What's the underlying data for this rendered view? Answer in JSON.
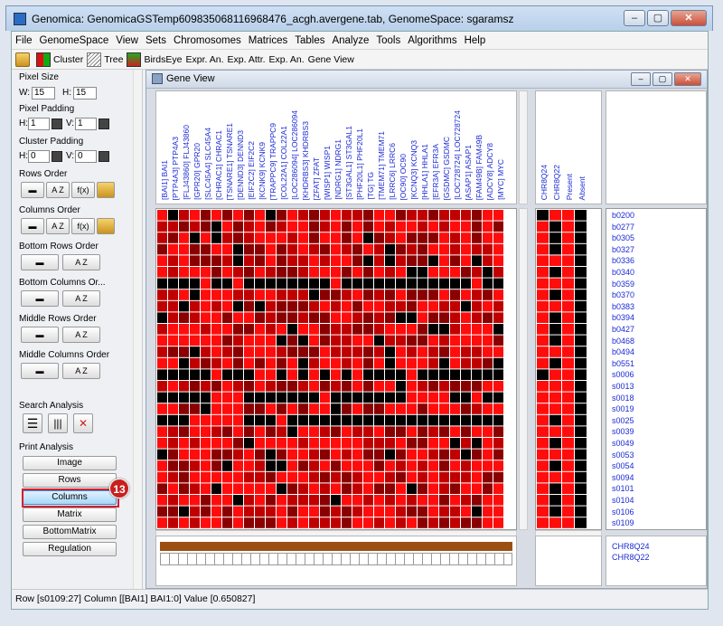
{
  "window": {
    "title": "Genomica: GenomicaGSTemp609835068116968476_acgh.avergene.tab, GenomeSpace: sgaramsz",
    "controls": [
      "–",
      "▢",
      "✕"
    ]
  },
  "menu": [
    "File",
    "GenomeSpace",
    "View",
    "Sets",
    "Chromosomes",
    "Matrices",
    "Tables",
    "Analyze",
    "Tools",
    "Algorithms",
    "Help"
  ],
  "toolbar": [
    "Cluster",
    "Tree",
    "BirdsEye",
    "Expr. An.",
    "Exp. Attr.",
    "Exp. An.",
    "Gene View"
  ],
  "left": {
    "pixel_size": "Pixel Size",
    "w_label": "W:",
    "w_value": "15",
    "h_label": "H:",
    "h_value": "15",
    "pixel_padding": "Pixel Padding",
    "pp_h_label": "H:",
    "pp_h_value": "1",
    "pp_v_label": "V:",
    "pp_v_value": "1",
    "cluster_padding": "Cluster Padding",
    "cp_h_label": "H:",
    "cp_h_value": "0",
    "cp_v_label": "V:",
    "cp_v_value": "0",
    "rows_order": "Rows Order",
    "columns_order": "Columns Order",
    "bottom_rows_order": "Bottom Rows Order",
    "bottom_columns_order": "Bottom Columns Or...",
    "middle_rows_order": "Middle Rows Order",
    "middle_columns_order": "Middle Columns Order",
    "search_analysis": "Search Analysis",
    "print_analysis": "Print Analysis",
    "print_buttons": [
      "Image",
      "Rows",
      "Columns",
      "Matrix",
      "BottomMatrix",
      "Regulation"
    ],
    "order_button_a": "A Z",
    "order_button_f": "f(x)",
    "badge": "13"
  },
  "gene_view": {
    "title": "Gene View",
    "controls": [
      "–",
      "▢",
      "✕"
    ],
    "columns": [
      "[BAI1] BAI1",
      "[PTP4A3] PTP4A3",
      "[FLJ43860] FLJ43860",
      "[GPR20] GPR20",
      "[SLC45A4] SLC45A4",
      "[CHRAC1] CHRAC1",
      "[TSNARE1] TSNARE1",
      "[DENND3] DENND3",
      "[EIF2C2] EIF2C2",
      "[KCNK9] KCNK9",
      "[TRAPPC9] TRAPPC9",
      "[COL22A1] COL22A1",
      "[LOC286094] LOC286094",
      "[KHDRBS3] KHDRBS3",
      "[ZFAT] ZFAT",
      "[WISP1] WISP1",
      "[NDRG1] NDRG1",
      "[ST3GAL1] ST3GAL1",
      "[PHF20L1] PHF20L1",
      "[TG] TG",
      "[TMEM71] TMEM71",
      "[LRRC6] LRRC6",
      "[OC90] OC90",
      "[KCNQ3] KCNQ3",
      "[HHLA1] HHLA1",
      "[EFR3A] EFR3A",
      "[GSDMC] GSDMC",
      "[LOC728724] LOC728724",
      "[ASAP1] ASAP1",
      "[FAM49B] FAM49B",
      "[ADCY8] ADCY8",
      "[MYC] MYC"
    ],
    "attr_columns": [
      "CHR8Q24",
      "CHR8Q22",
      "Present",
      "Absent"
    ],
    "rows": [
      "b0200",
      "b0277",
      "b0305",
      "b0327",
      "b0336",
      "b0340",
      "b0359",
      "b0370",
      "b0383",
      "b0394",
      "b0427",
      "b0468",
      "b0494",
      "b0551",
      "s0006",
      "s0013",
      "s0018",
      "s0019",
      "s0025",
      "s0039",
      "s0049",
      "s0053",
      "s0054",
      "s0094",
      "s0101",
      "s0104",
      "s0106",
      "s0109"
    ],
    "bottom_labels": [
      "CHR8Q24",
      "CHR8Q22"
    ],
    "attr_values": [
      [
        0,
        1,
        1,
        0
      ],
      [
        1,
        0,
        1,
        0
      ],
      [
        1,
        0,
        1,
        0
      ],
      [
        1,
        0,
        1,
        0
      ],
      [
        1,
        1,
        1,
        0
      ],
      [
        1,
        0,
        1,
        0
      ],
      [
        1,
        1,
        1,
        0
      ],
      [
        1,
        0,
        1,
        0
      ],
      [
        1,
        1,
        1,
        0
      ],
      [
        1,
        0,
        1,
        0
      ],
      [
        1,
        0,
        1,
        0
      ],
      [
        1,
        0,
        1,
        0
      ],
      [
        1,
        1,
        1,
        0
      ],
      [
        1,
        0,
        1,
        0
      ],
      [
        0,
        1,
        1,
        0
      ],
      [
        1,
        1,
        1,
        0
      ],
      [
        1,
        1,
        1,
        0
      ],
      [
        1,
        1,
        1,
        0
      ],
      [
        1,
        0,
        1,
        0
      ],
      [
        1,
        1,
        1,
        0
      ],
      [
        1,
        0,
        1,
        0
      ],
      [
        1,
        1,
        1,
        0
      ],
      [
        1,
        0,
        1,
        0
      ],
      [
        1,
        1,
        1,
        0
      ],
      [
        1,
        0,
        1,
        0
      ],
      [
        1,
        0,
        1,
        0
      ],
      [
        1,
        0,
        1,
        0
      ],
      [
        1,
        1,
        1,
        0
      ]
    ]
  },
  "status": "Row [s0109:27] Column [[BAI1] BAI1:0] Value [0.650827]"
}
